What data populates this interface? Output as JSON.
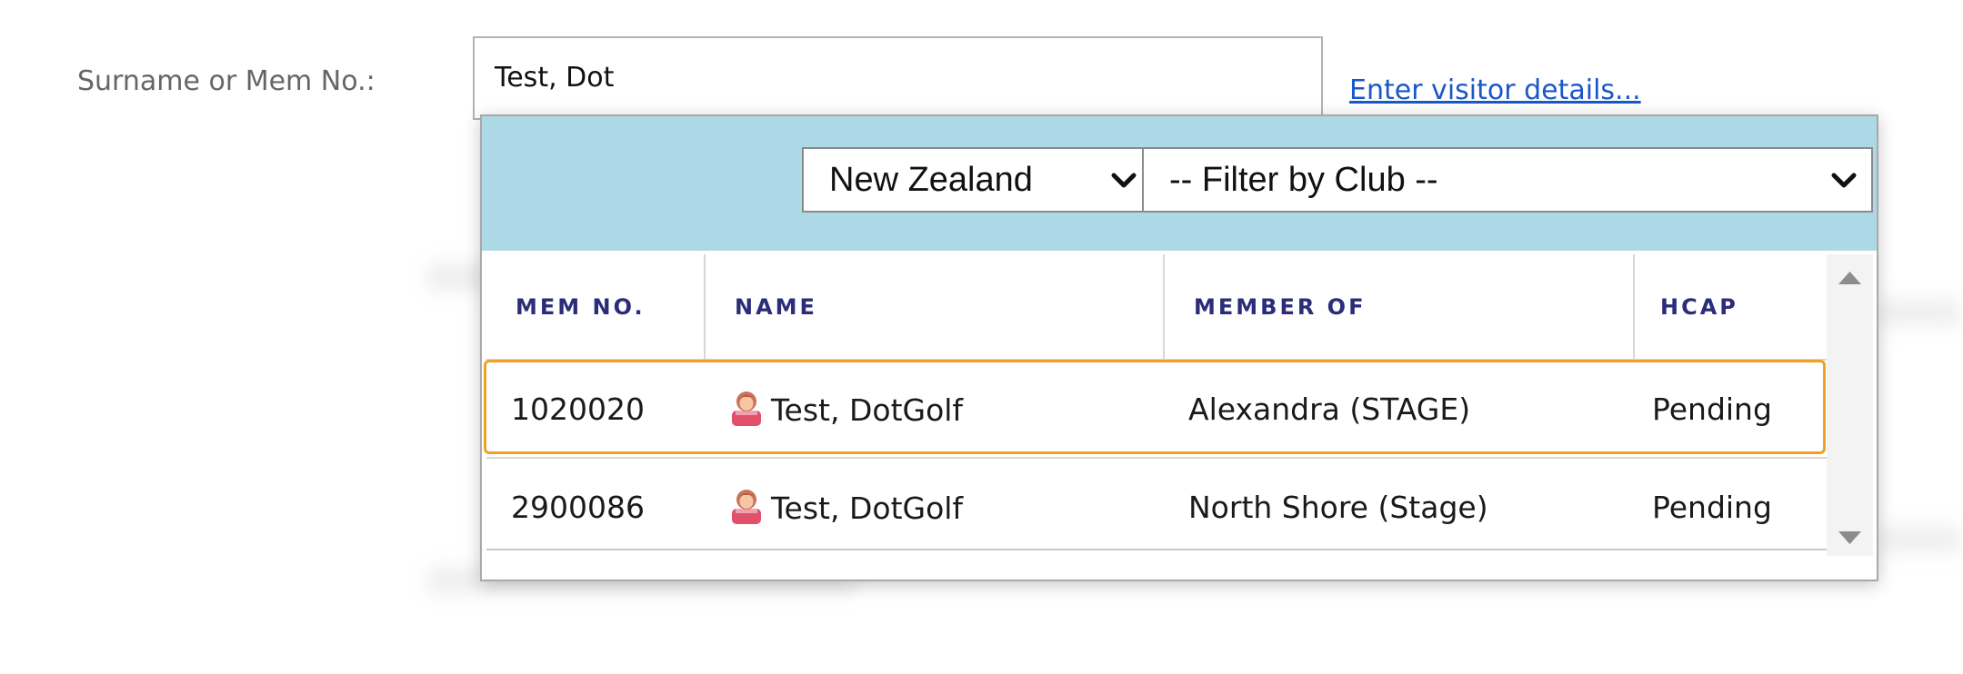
{
  "form": {
    "label": "Surname or Mem No.:",
    "search_value": "Test, Dot",
    "visitor_link": "Enter visitor details..."
  },
  "filters": {
    "country": "New Zealand",
    "club": "-- Filter by Club --"
  },
  "table": {
    "headers": [
      "MEM NO.",
      "NAME",
      "MEMBER OF",
      "HCAP"
    ],
    "rows": [
      {
        "mem_no": "1020020",
        "name": "Test, DotGolf",
        "member_of": "Alexandra (STAGE)",
        "hcap": "Pending",
        "icon": "female-person-icon"
      },
      {
        "mem_no": "2900086",
        "name": "Test, DotGolf",
        "member_of": "North Shore (Stage)",
        "hcap": "Pending",
        "icon": "female-person-icon"
      }
    ]
  },
  "colors": {
    "filter_bar": "#add8e6",
    "header_text": "#2b2d7a",
    "highlight": "#f0a025",
    "link": "#1a57c9"
  }
}
